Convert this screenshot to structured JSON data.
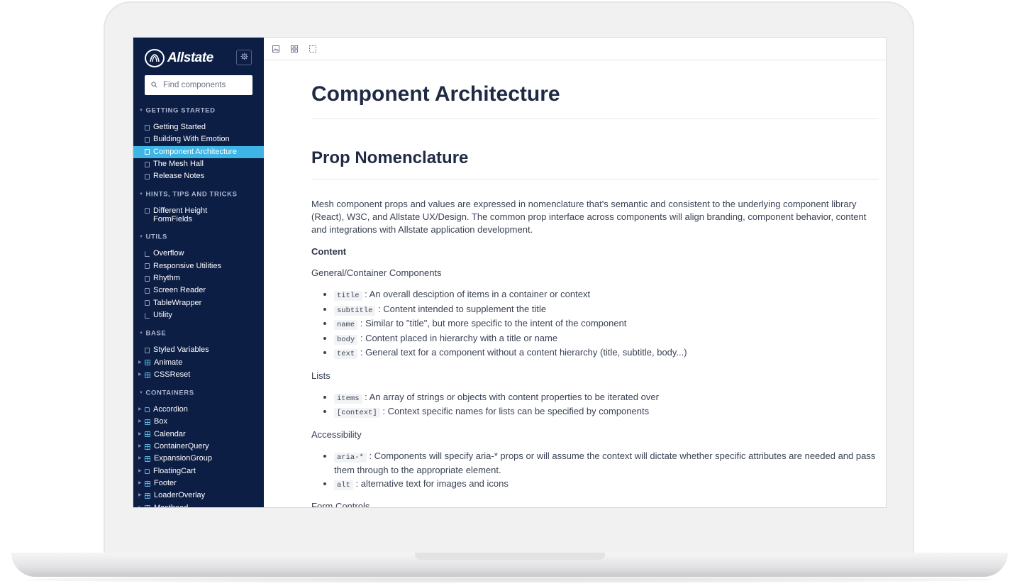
{
  "sidebar": {
    "brand": "Allstate",
    "search_placeholder": "Find components",
    "sections": [
      {
        "title": "GETTING STARTED",
        "items": [
          "Getting Started",
          "Building With Emotion",
          "Component Architecture",
          "The Mesh Hall",
          "Release Notes"
        ]
      },
      {
        "title": "HINTS, TIPS AND TRICKS",
        "items": [
          "Different Height FormFields"
        ]
      },
      {
        "title": "UTILS",
        "items": [
          "Overflow",
          "Responsive Utilities",
          "Rhythm",
          "Screen Reader",
          "TableWrapper",
          "Utility"
        ]
      },
      {
        "title": "BASE",
        "items": [
          "Styled Variables",
          "Animate",
          "CSSReset"
        ]
      },
      {
        "title": "CONTAINERS",
        "items": [
          "Accordion",
          "Box",
          "Calendar",
          "ContainerQuery",
          "ExpansionGroup",
          "FloatingCart",
          "Footer",
          "LoaderOverlay",
          "Masthead"
        ]
      }
    ],
    "active_item": "Component Architecture"
  },
  "toolbar": {
    "icons": [
      "image-icon",
      "grid-icon",
      "frame-icon"
    ]
  },
  "content": {
    "title": "Component Architecture",
    "section_title": "Prop Nomenclature",
    "intro": "Mesh component props and values are expressed in nomenclature that's semantic and consistent to the underlying component library (React), W3C, and Allstate UX/Design. The common prop interface across components will align branding, component behavior, content and integrations with Allstate application development.",
    "content_label": "Content",
    "general_label": "General/Container Components",
    "general_items": [
      {
        "code": "title",
        "text": ": An overall desciption of items in a container or context"
      },
      {
        "code": "subtitle",
        "text": ": Content intended to supplement the title"
      },
      {
        "code": "name",
        "text": ": Similar to \"title\", but more specific to the intent of the component"
      },
      {
        "code": "body",
        "text": ": Content placed in hierarchy with a title or name"
      },
      {
        "code": "text",
        "text": ": General text for a component without a content hierarchy (title, subtitle, body...)"
      }
    ],
    "lists_label": "Lists",
    "lists_items": [
      {
        "code": "items",
        "text": ": An array of strings or objects with content properties to be iterated over"
      },
      {
        "code": "[context]",
        "text": ": Context specific names for lists can be specified by components"
      }
    ],
    "accessibility_label": "Accessibility",
    "accessibility_items": [
      {
        "code": "aria-*",
        "text": ": Components will specify aria-* props or will assume the context will dictate whether specific attributes are needed and pass them through to the appropriate element."
      },
      {
        "code": "alt",
        "text": ": alternative text for images and icons"
      }
    ],
    "form_controls_label": "Form Controls"
  },
  "colors": {
    "sidebar_bg": "#0d1e45",
    "active_bg": "#3fb5e5",
    "heading": "#1f2a44"
  }
}
